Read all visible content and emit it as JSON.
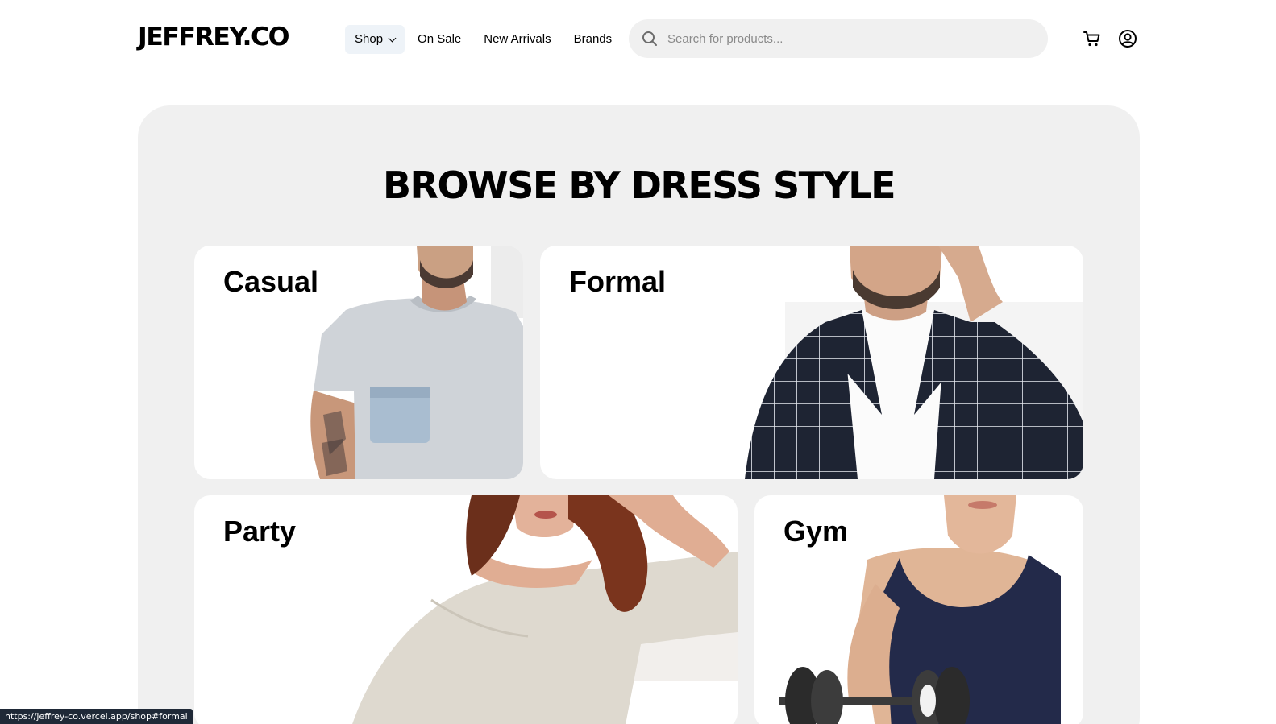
{
  "header": {
    "logo": "JEFFREY.CO",
    "nav": [
      {
        "label": "Shop",
        "has_dropdown": true,
        "active": true
      },
      {
        "label": "On Sale"
      },
      {
        "label": "New Arrivals"
      },
      {
        "label": "Brands"
      }
    ],
    "search": {
      "placeholder": "Search for products...",
      "value": "",
      "icon": "search-icon"
    },
    "icons": [
      "cart-icon",
      "account-icon"
    ]
  },
  "dress_style": {
    "title": "BROWSE BY DRESS STYLE",
    "cards": [
      {
        "label": "Casual"
      },
      {
        "label": "Formal"
      },
      {
        "label": "Party"
      },
      {
        "label": "Gym"
      }
    ]
  },
  "status_bar": {
    "url": "https://jeffrey-co.vercel.app/shop#formal"
  },
  "colors": {
    "background": "#ffffff",
    "section_bg": "#f0f0f0",
    "text": "#000000",
    "active_nav_bg": "#eef3f8"
  }
}
